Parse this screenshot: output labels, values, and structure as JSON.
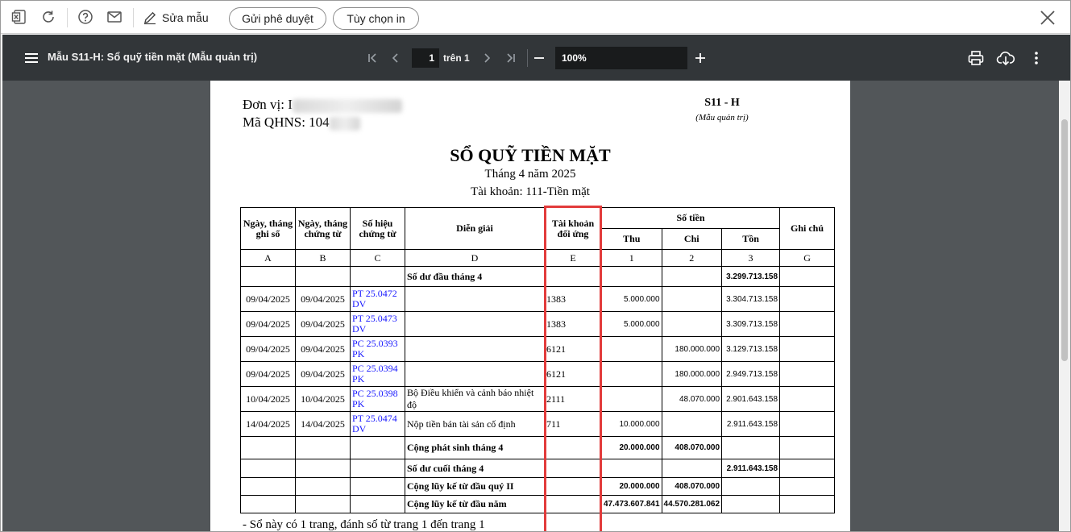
{
  "toolbar": {
    "edit_label": "Sửa mẫu",
    "send_approval_label": "Gửi phê duyệt",
    "print_options_label": "Tùy chọn in"
  },
  "viewer": {
    "title": "Mẫu S11-H: Sổ quỹ tiền mặt (Mẫu quản trị)",
    "page_current": "1",
    "page_of": "trên 1",
    "zoom": "100%"
  },
  "document": {
    "unit_label": "Đơn vị: ",
    "unit_visible": "I",
    "qhns_label": "Mã QHNS: ",
    "qhns_visible": "104",
    "form_code": "S11 - H",
    "form_note": "(Mẫu quản trị)",
    "heading": "SỔ QUỸ TIỀN MẶT",
    "period": "Tháng 4 năm 2025",
    "account": "Tài khoản: 111-Tiền mặt",
    "footnote": "- Sổ này có 1 trang, đánh số từ trang 1 đến trang 1"
  },
  "ledger": {
    "headers": {
      "record_date": "Ngày, tháng ghi sổ",
      "voucher_date": "Ngày, tháng chứng từ",
      "voucher_no": "Số hiệu chứng từ",
      "description": "Diễn giải",
      "contra_account": "Tài khoản đối ứng",
      "amount": "Số tiền",
      "receipt": "Thu",
      "payment": "Chi",
      "balance": "Tồn",
      "note": "Ghi chú"
    },
    "codes": [
      "A",
      "B",
      "C",
      "D",
      "E",
      "1",
      "2",
      "3",
      "G"
    ],
    "opening": {
      "label": "Số dư đầu tháng 4",
      "balance": "3.299.713.158"
    },
    "rows": [
      {
        "record_date": "09/04/2025",
        "voucher_date": "09/04/2025",
        "voucher_no": "PT 25.0472 DV",
        "description": "",
        "account": "1383",
        "receipt": "5.000.000",
        "payment": "",
        "balance": "3.304.713.158"
      },
      {
        "record_date": "09/04/2025",
        "voucher_date": "09/04/2025",
        "voucher_no": "PT 25.0473 DV",
        "description": "",
        "account": "1383",
        "receipt": "5.000.000",
        "payment": "",
        "balance": "3.309.713.158"
      },
      {
        "record_date": "09/04/2025",
        "voucher_date": "09/04/2025",
        "voucher_no": "PC 25.0393 PK",
        "description": "",
        "account": "6121",
        "receipt": "",
        "payment": "180.000.000",
        "balance": "3.129.713.158"
      },
      {
        "record_date": "09/04/2025",
        "voucher_date": "09/04/2025",
        "voucher_no": "PC 25.0394 PK",
        "description": "",
        "account": "6121",
        "receipt": "",
        "payment": "180.000.000",
        "balance": "2.949.713.158"
      },
      {
        "record_date": "10/04/2025",
        "voucher_date": "10/04/2025",
        "voucher_no": "PC 25.0398 PK",
        "description": "Bộ Điều khiển và cảnh báo nhiệt độ",
        "account": "2111",
        "receipt": "",
        "payment": "48.070.000",
        "balance": "2.901.643.158"
      },
      {
        "record_date": "14/04/2025",
        "voucher_date": "14/04/2025",
        "voucher_no": "PT 25.0474 DV",
        "description": "Nộp tiền bán tài sản cố định",
        "account": "711",
        "receipt": "10.000.000",
        "payment": "",
        "balance": "2.911.643.158"
      }
    ],
    "month_total": {
      "label": "Cộng phát sinh tháng 4",
      "receipt": "20.000.000",
      "payment": "408.070.000"
    },
    "closing": {
      "label": "Số dư cuối tháng 4",
      "balance": "2.911.643.158"
    },
    "quarter_total": {
      "label": "Cộng lũy kế từ đầu quý II",
      "receipt": "20.000.000",
      "payment": "408.070.000"
    },
    "year_total": {
      "label": "Cộng lũy kế từ đầu năm",
      "receipt": "47.473.607.841",
      "payment": "44.570.281.062"
    }
  },
  "colors": {
    "highlight": "#e23b3b",
    "voucher_link": "#1a1aff",
    "viewer_bar": "#323639"
  }
}
